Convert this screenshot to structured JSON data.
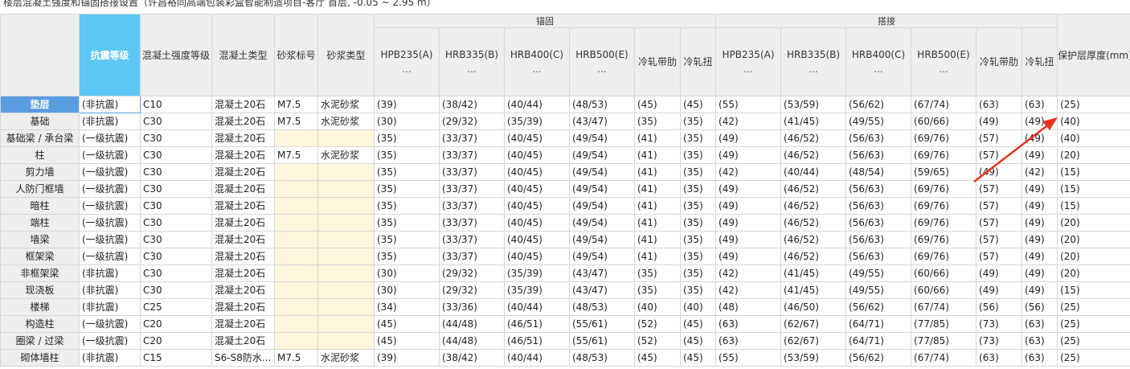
{
  "caption": "楼层混凝土强度和锚固搭接设置（许昌裕同高端包装彩盒智能制造项目-客厅 首层, -0.05 ~ 2.95 m）",
  "groups": {
    "anchor": "锚固",
    "lap": "搭接"
  },
  "columns": {
    "seismic": "抗震等级",
    "concrete_grade": "混凝土强度等级",
    "concrete_type": "混凝土类型",
    "mortar_grade": "砂浆标号",
    "mortar_type": "砂浆类型",
    "steel": [
      "HPB235(A)",
      "HRB335(B)",
      "HRB400(C)",
      "HRB500(E)",
      "冷轧带肋",
      "冷轧扭"
    ],
    "steel_sub": "...",
    "cover": "保护层厚度(mm)"
  },
  "rows": [
    {
      "name": "垫层",
      "seismic": "(非抗震)",
      "grade": "C10",
      "ctype": "混凝土20石",
      "mgrade": "M7.5",
      "mtype": "水泥砂浆",
      "anchor": [
        "(39)",
        "(38/42)",
        "(40/44)",
        "(48/53)",
        "(45)",
        "(45)"
      ],
      "lap": [
        "(55)",
        "(53/59)",
        "(56/62)",
        "(67/74)",
        "(63)",
        "(63)"
      ],
      "cover": "(25)"
    },
    {
      "name": "基础",
      "seismic": "(非抗震)",
      "grade": "C30",
      "ctype": "混凝土20石",
      "mgrade": "M7.5",
      "mtype": "水泥砂浆",
      "anchor": [
        "(30)",
        "(29/32)",
        "(35/39)",
        "(43/47)",
        "(35)",
        "(35)"
      ],
      "lap": [
        "(42)",
        "(41/45)",
        "(49/55)",
        "(60/66)",
        "(49)",
        "(49)"
      ],
      "cover": "(40)"
    },
    {
      "name": "基础梁 / 承台梁",
      "seismic": "(一级抗震)",
      "grade": "C30",
      "ctype": "混凝土20石",
      "mgrade": "",
      "mtype": "",
      "anchor": [
        "(35)",
        "(33/37)",
        "(40/45)",
        "(49/54)",
        "(41)",
        "(35)"
      ],
      "lap": [
        "(49)",
        "(46/52)",
        "(56/63)",
        "(69/76)",
        "(57)",
        "(49)"
      ],
      "cover": "(40)"
    },
    {
      "name": "柱",
      "seismic": "(一级抗震)",
      "grade": "C30",
      "ctype": "混凝土20石",
      "mgrade": "M7.5",
      "mtype": "水泥砂浆",
      "anchor": [
        "(35)",
        "(33/37)",
        "(40/45)",
        "(49/54)",
        "(41)",
        "(35)"
      ],
      "lap": [
        "(49)",
        "(46/52)",
        "(56/63)",
        "(69/76)",
        "(57)",
        "(49)"
      ],
      "cover": "(20)"
    },
    {
      "name": "剪力墙",
      "seismic": "(一级抗震)",
      "grade": "C30",
      "ctype": "混凝土20石",
      "mgrade": "",
      "mtype": "",
      "anchor": [
        "(35)",
        "(33/37)",
        "(40/45)",
        "(49/54)",
        "(41)",
        "(35)"
      ],
      "lap": [
        "(42)",
        "(40/44)",
        "(48/54)",
        "(59/65)",
        "(49)",
        "(42)"
      ],
      "cover": "(15)"
    },
    {
      "name": "人防门框墙",
      "seismic": "(一级抗震)",
      "grade": "C30",
      "ctype": "混凝土20石",
      "mgrade": "",
      "mtype": "",
      "anchor": [
        "(35)",
        "(33/37)",
        "(40/45)",
        "(49/54)",
        "(41)",
        "(35)"
      ],
      "lap": [
        "(49)",
        "(46/52)",
        "(56/63)",
        "(69/76)",
        "(57)",
        "(49)"
      ],
      "cover": "(15)"
    },
    {
      "name": "暗柱",
      "seismic": "(一级抗震)",
      "grade": "C30",
      "ctype": "混凝土20石",
      "mgrade": "",
      "mtype": "",
      "anchor": [
        "(35)",
        "(33/37)",
        "(40/45)",
        "(49/54)",
        "(41)",
        "(35)"
      ],
      "lap": [
        "(49)",
        "(46/52)",
        "(56/63)",
        "(69/76)",
        "(57)",
        "(49)"
      ],
      "cover": "(15)"
    },
    {
      "name": "端柱",
      "seismic": "(一级抗震)",
      "grade": "C30",
      "ctype": "混凝土20石",
      "mgrade": "",
      "mtype": "",
      "anchor": [
        "(35)",
        "(33/37)",
        "(40/45)",
        "(49/54)",
        "(41)",
        "(35)"
      ],
      "lap": [
        "(49)",
        "(46/52)",
        "(56/63)",
        "(69/76)",
        "(57)",
        "(49)"
      ],
      "cover": "(20)"
    },
    {
      "name": "墙梁",
      "seismic": "(一级抗震)",
      "grade": "C30",
      "ctype": "混凝土20石",
      "mgrade": "",
      "mtype": "",
      "anchor": [
        "(35)",
        "(33/37)",
        "(40/45)",
        "(49/54)",
        "(41)",
        "(35)"
      ],
      "lap": [
        "(49)",
        "(46/52)",
        "(56/63)",
        "(69/76)",
        "(57)",
        "(49)"
      ],
      "cover": "(20)"
    },
    {
      "name": "框架梁",
      "seismic": "(一级抗震)",
      "grade": "C30",
      "ctype": "混凝土20石",
      "mgrade": "",
      "mtype": "",
      "anchor": [
        "(35)",
        "(33/37)",
        "(40/45)",
        "(49/54)",
        "(41)",
        "(35)"
      ],
      "lap": [
        "(49)",
        "(46/52)",
        "(56/63)",
        "(69/76)",
        "(57)",
        "(49)"
      ],
      "cover": "(20)"
    },
    {
      "name": "非框架梁",
      "seismic": "(非抗震)",
      "grade": "C30",
      "ctype": "混凝土20石",
      "mgrade": "",
      "mtype": "",
      "anchor": [
        "(30)",
        "(29/32)",
        "(35/39)",
        "(43/47)",
        "(35)",
        "(35)"
      ],
      "lap": [
        "(42)",
        "(41/45)",
        "(49/55)",
        "(60/66)",
        "(49)",
        "(49)"
      ],
      "cover": "(20)"
    },
    {
      "name": "现浇板",
      "seismic": "(非抗震)",
      "grade": "C30",
      "ctype": "混凝土20石",
      "mgrade": "",
      "mtype": "",
      "anchor": [
        "(30)",
        "(29/32)",
        "(35/39)",
        "(43/47)",
        "(35)",
        "(35)"
      ],
      "lap": [
        "(42)",
        "(41/45)",
        "(49/55)",
        "(60/66)",
        "(49)",
        "(49)"
      ],
      "cover": "(15)"
    },
    {
      "name": "楼梯",
      "seismic": "(非抗震)",
      "grade": "C25",
      "ctype": "混凝土20石",
      "mgrade": "",
      "mtype": "",
      "anchor": [
        "(34)",
        "(33/36)",
        "(40/44)",
        "(48/53)",
        "(40)",
        "(40)"
      ],
      "lap": [
        "(48)",
        "(46/50)",
        "(56/62)",
        "(67/74)",
        "(56)",
        "(56)"
      ],
      "cover": "(25)"
    },
    {
      "name": "构造柱",
      "seismic": "(一级抗震)",
      "grade": "C20",
      "ctype": "混凝土20石",
      "mgrade": "",
      "mtype": "",
      "anchor": [
        "(45)",
        "(44/48)",
        "(46/51)",
        "(55/61)",
        "(52)",
        "(45)"
      ],
      "lap": [
        "(63)",
        "(62/67)",
        "(64/71)",
        "(77/85)",
        "(73)",
        "(63)"
      ],
      "cover": "(25)"
    },
    {
      "name": "圈梁 / 过梁",
      "seismic": "(一级抗震)",
      "grade": "C20",
      "ctype": "混凝土20石",
      "mgrade": "",
      "mtype": "",
      "anchor": [
        "(45)",
        "(44/48)",
        "(46/51)",
        "(55/61)",
        "(52)",
        "(45)"
      ],
      "lap": [
        "(63)",
        "(62/67)",
        "(64/71)",
        "(77/85)",
        "(73)",
        "(63)"
      ],
      "cover": "(25)"
    },
    {
      "name": "砌体墙柱",
      "seismic": "(非抗震)",
      "grade": "C15",
      "ctype": "S6-S8防水...",
      "mgrade": "M7.5",
      "mtype": "水泥砂浆",
      "anchor": [
        "(39)",
        "(38/42)",
        "(40/44)",
        "(48/53)",
        "(45)",
        "(45)"
      ],
      "lap": [
        "(55)",
        "(53/59)",
        "(56/62)",
        "(67/74)",
        "(63)",
        "(63)"
      ],
      "cover": "(25)"
    }
  ],
  "colors": {
    "selected_header": "#5dc8f6",
    "selected_row": "#5b9ee0",
    "empty_cell": "#fdf6dc",
    "annotation_arrow": "#e8321e"
  },
  "icons": {
    "annotation": "red-arrow-icon"
  }
}
